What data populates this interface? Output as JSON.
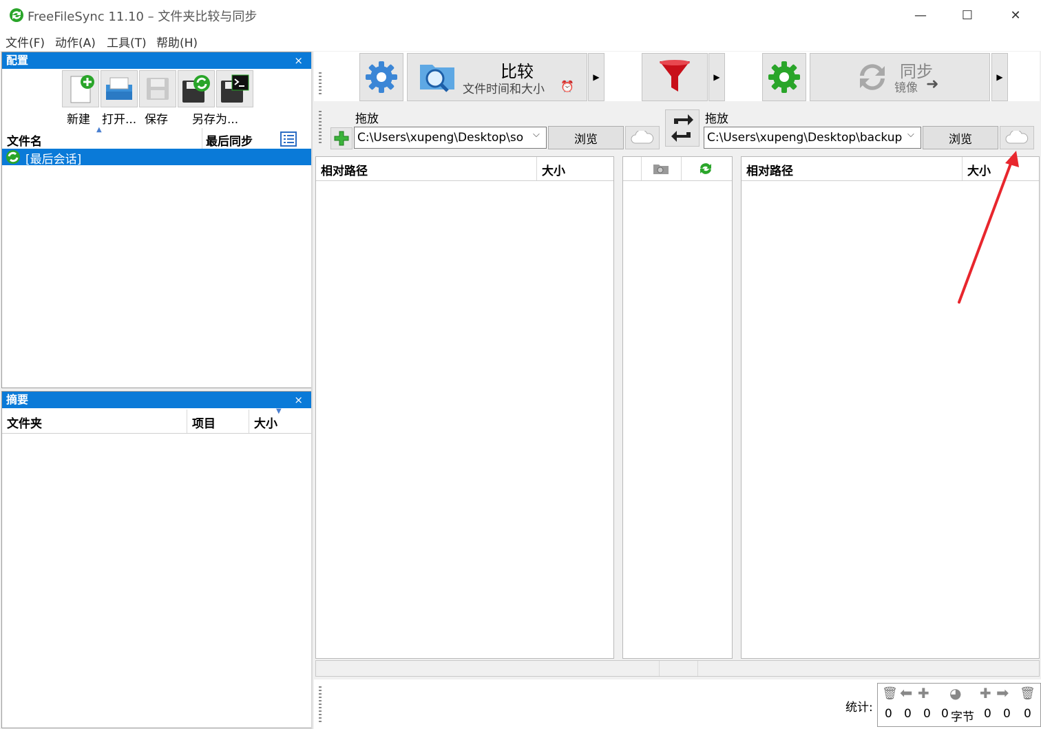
{
  "window": {
    "title": "FreeFileSync 11.10 – 文件夹比较与同步",
    "minimize": "—",
    "maximize": "☐",
    "close": "✕"
  },
  "menu": [
    {
      "label": "文件(F)"
    },
    {
      "label": "动作(A)"
    },
    {
      "label": "工具(T)"
    },
    {
      "label": "帮助(H)"
    }
  ],
  "config_panel": {
    "title": "配置",
    "close": "×",
    "toolbar": {
      "new": "新建",
      "open": "打开...",
      "save": "保存",
      "save_as": "另存为..."
    },
    "columns": {
      "name": "文件名",
      "last_sync": "最后同步"
    },
    "rows": [
      {
        "label": "[最后会话]"
      }
    ]
  },
  "summary_panel": {
    "title": "摘要",
    "close": "×",
    "columns": {
      "folder": "文件夹",
      "items": "项目",
      "size": "大小"
    }
  },
  "main_toolbar": {
    "compare": {
      "title": "比较",
      "subtitle": "文件时间和大小"
    },
    "sync": {
      "title": "同步",
      "subtitle": "镜像"
    }
  },
  "left_folder": {
    "drop_label": "拖放",
    "path": "C:\\Users\\xupeng\\Desktop\\so",
    "browse": "浏览"
  },
  "right_folder": {
    "drop_label": "拖放",
    "path": "C:\\Users\\xupeng\\Desktop\\backup",
    "browse": "浏览"
  },
  "grid": {
    "left": {
      "path": "相对路径",
      "size": "大小"
    },
    "right": {
      "path": "相对路径",
      "size": "大小"
    }
  },
  "stats": {
    "label": "统计:",
    "values": [
      "0",
      "0",
      "0",
      "0",
      "字节",
      "0",
      "0",
      "0"
    ]
  },
  "colors": {
    "accent": "#0a7ad8",
    "annotation": "#e8262d",
    "green": "#2aa52a",
    "filter_red": "#c8101a"
  }
}
